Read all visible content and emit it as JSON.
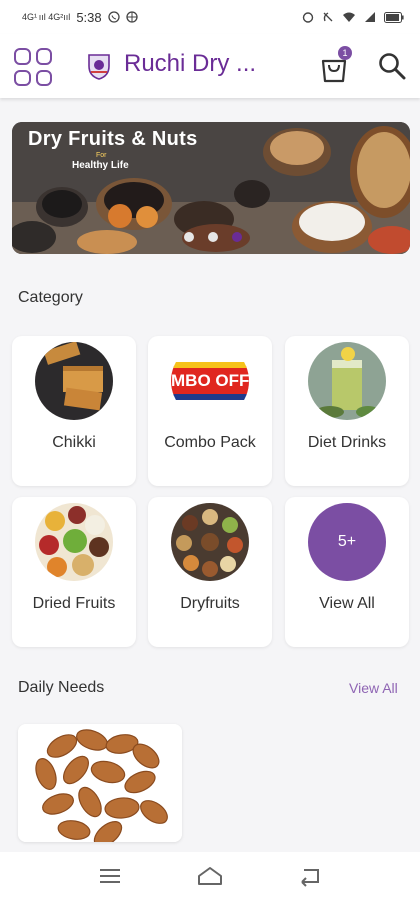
{
  "status_bar": {
    "signal": "4G¹ ııl 4G²ııl",
    "time": "5:38"
  },
  "app_bar": {
    "title": "Ruchi Dry ...",
    "cart_count": "1",
    "accent": "#6a2c96"
  },
  "banner": {
    "title": "Dry Fruits & Nuts",
    "for_text": "For",
    "subtitle": "Healthy Life",
    "slides": 3,
    "active_slide": 3
  },
  "category": {
    "title": "Category",
    "items": [
      {
        "label": "Chikki",
        "icon": "chikki-image"
      },
      {
        "label": "Combo Pack",
        "icon": "combo-pack-image",
        "image_text": "MBO OFFE"
      },
      {
        "label": "Diet Drinks",
        "icon": "diet-drinks-image"
      },
      {
        "label": "Dried Fruits",
        "icon": "dried-fruits-image"
      },
      {
        "label": "Dryfruits",
        "icon": "dryfruits-image"
      },
      {
        "label": "View All",
        "icon": "more-circle",
        "badge": "5+"
      }
    ]
  },
  "daily_needs": {
    "title": "Daily Needs",
    "view_all": "View All",
    "products": [
      {
        "image": "almonds-image"
      }
    ]
  },
  "nav_bar": {
    "items": [
      "menu-icon",
      "home-icon",
      "back-icon"
    ]
  }
}
